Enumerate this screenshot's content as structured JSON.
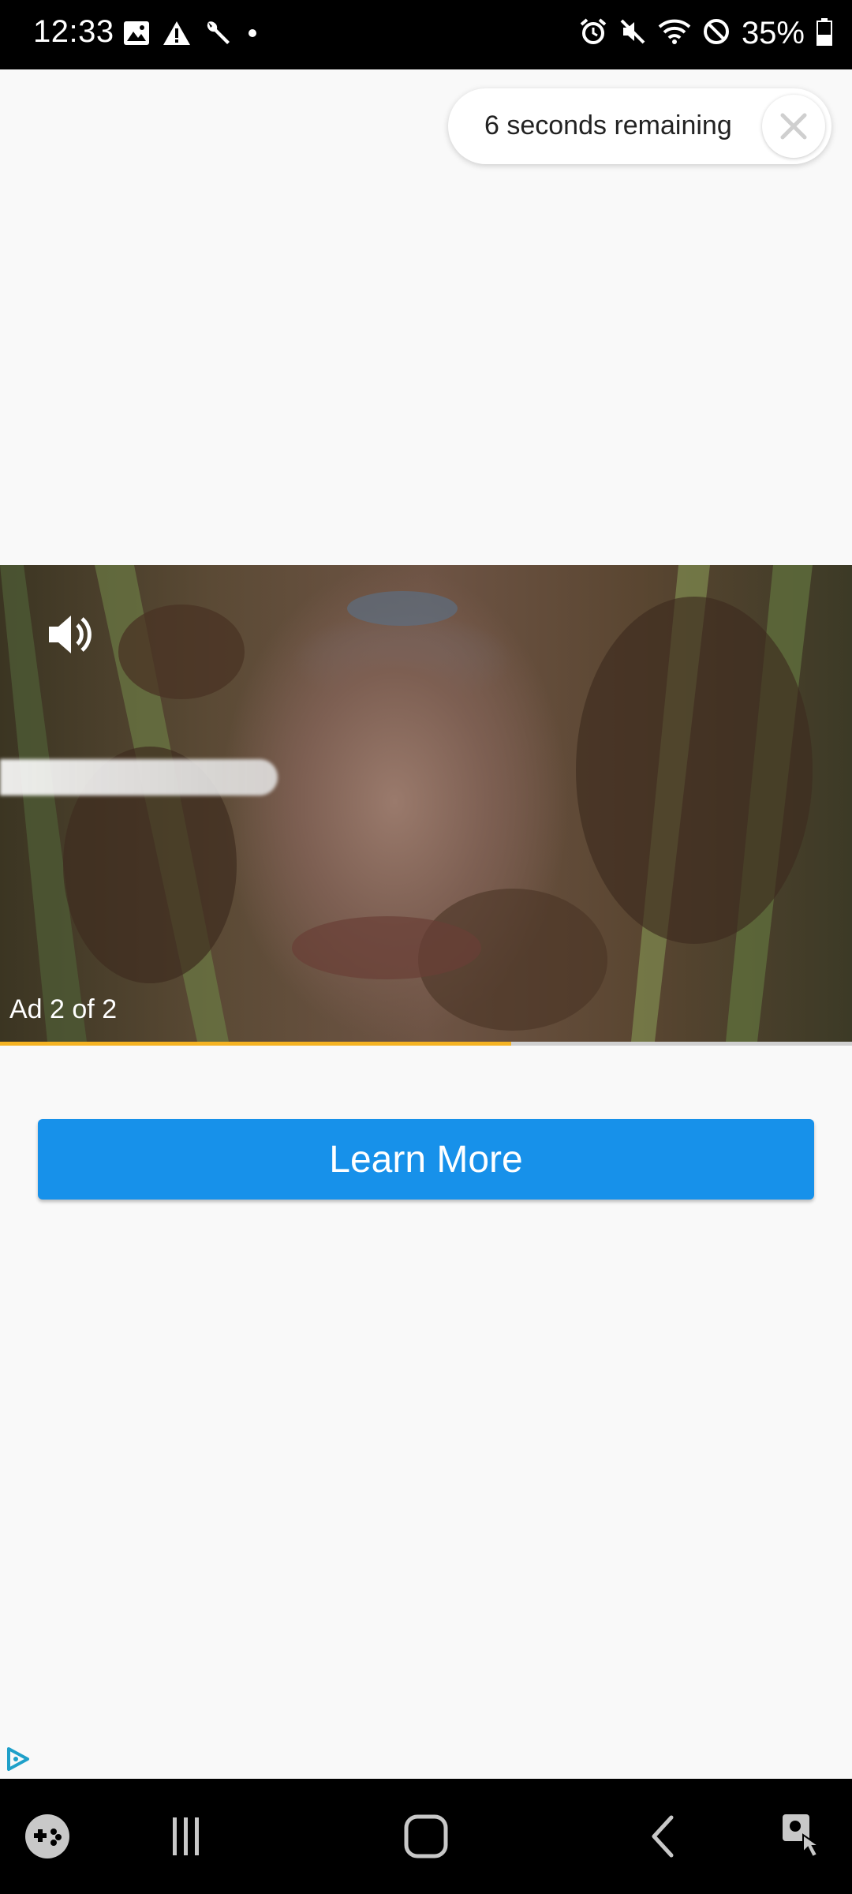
{
  "status_bar": {
    "time": "12:33",
    "battery_text": "35%"
  },
  "ad": {
    "skip_text": "6 seconds remaining",
    "ad_label": "Ad 2 of 2",
    "progress": 0.6,
    "cta_label": "Learn More"
  },
  "colors": {
    "cta": "#1791ea",
    "progress": "#f5b323"
  },
  "nav": {
    "icons": [
      "game-launcher-icon",
      "recents-icon",
      "home-icon",
      "back-icon",
      "accessibility-icon"
    ]
  }
}
